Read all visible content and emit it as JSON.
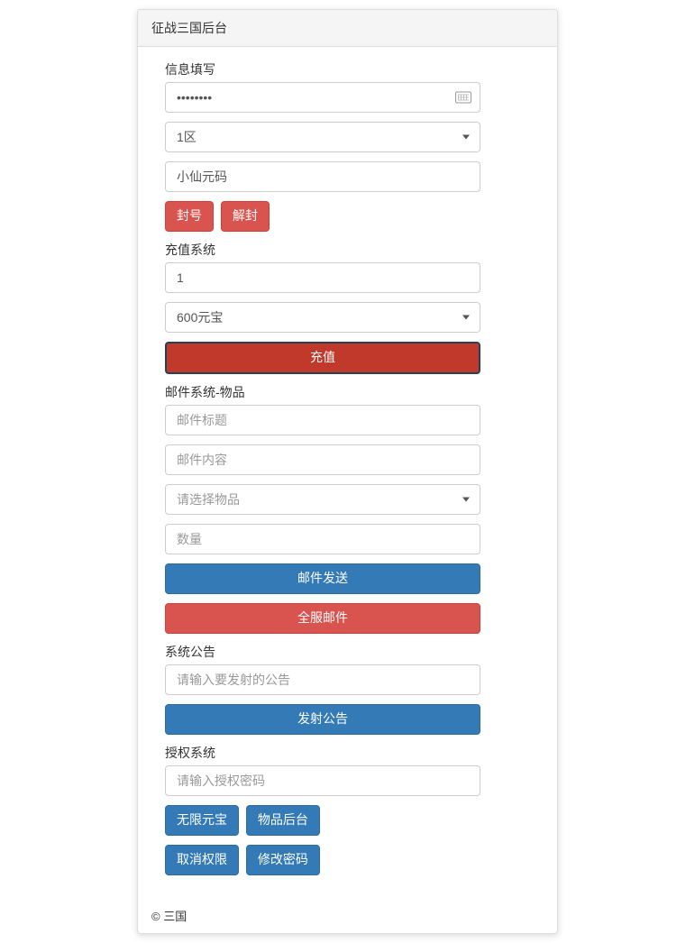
{
  "header": {
    "title": "征战三国后台"
  },
  "info": {
    "label": "信息填写",
    "password_value": "••••••••",
    "district_value": "1区",
    "code_value": "小仙元码",
    "ban_btn": "封号",
    "unban_btn": "解封"
  },
  "recharge": {
    "label": "充值系统",
    "amount_value": "1",
    "option_value": "600元宝",
    "submit_btn": "充值"
  },
  "mail": {
    "label": "邮件系统-物品",
    "title_placeholder": "邮件标题",
    "content_placeholder": "邮件内容",
    "item_placeholder": "请选择物品",
    "qty_placeholder": "数量",
    "send_btn": "邮件发送",
    "global_btn": "全服邮件"
  },
  "announce": {
    "label": "系统公告",
    "placeholder": "请输入要发射的公告",
    "submit_btn": "发射公告"
  },
  "auth": {
    "label": "授权系统",
    "placeholder": "请输入授权密码",
    "unlimited_btn": "无限元宝",
    "items_btn": "物品后台",
    "revoke_btn": "取消权限",
    "changepw_btn": "修改密码"
  },
  "footer": {
    "text": "© 三国"
  }
}
